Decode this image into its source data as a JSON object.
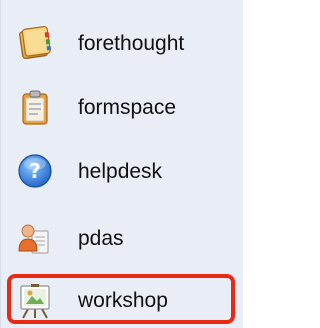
{
  "list": {
    "items": [
      {
        "label": "forethought",
        "icon": "notebook-icon"
      },
      {
        "label": "formspace",
        "icon": "clipboard-icon"
      },
      {
        "label": "helpdesk",
        "icon": "help-icon"
      },
      {
        "label": "pdas",
        "icon": "user-document-icon"
      },
      {
        "label": "workshop",
        "icon": "easel-icon"
      }
    ]
  },
  "highlight": {
    "target": "workshop",
    "color": "#e82a14"
  }
}
